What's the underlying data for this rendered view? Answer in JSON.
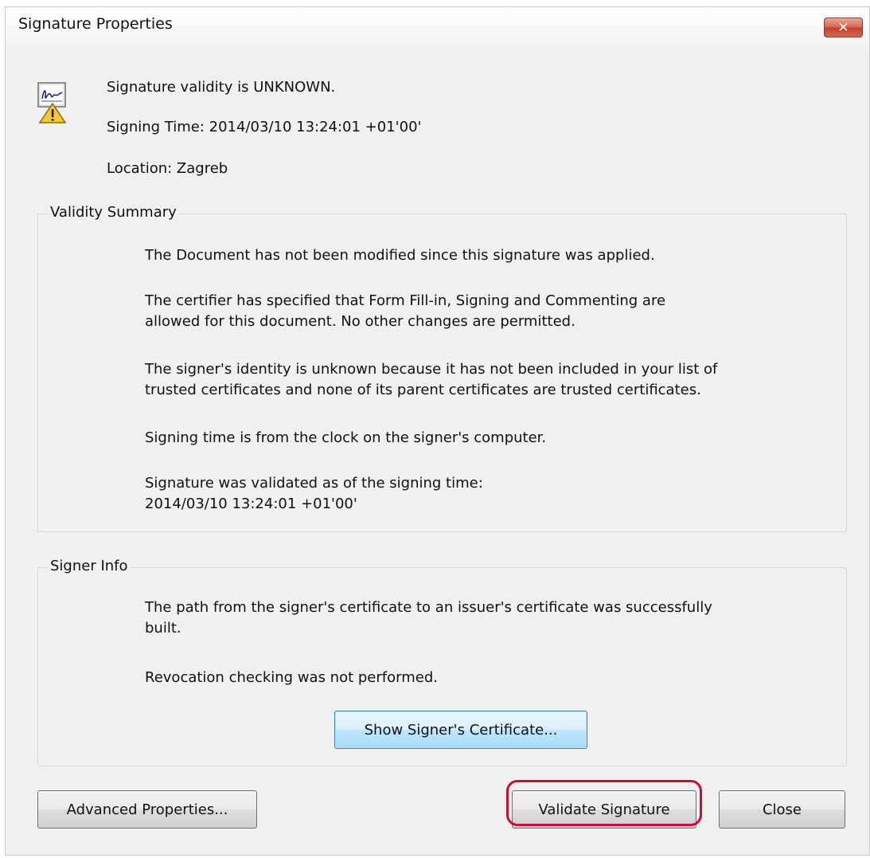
{
  "window": {
    "title": "Signature Properties",
    "close_glyph": "✕"
  },
  "header": {
    "icon": "signature-warning-icon",
    "validity": "Signature validity is UNKNOWN.",
    "signing_time": "Signing Time:  2014/03/10 13:24:01 +01'00'",
    "location": "Location:  Zagreb"
  },
  "validity_summary": {
    "label": "Validity Summary",
    "p1": "The Document has not been modified since this signature was applied.",
    "p2_l1": "The certifier has specified that Form Fill-in, Signing and Commenting are",
    "p2_l2": "allowed for this document. No other changes are permitted.",
    "p3_l1": "The signer's identity is unknown because it has not been included in your list of",
    "p3_l2": "trusted certificates and none of its parent certificates are trusted certificates.",
    "p4": "Signing time is from the clock on the signer's computer.",
    "p5_l1": "Signature was validated as of the signing time:",
    "p5_l2": "2014/03/10 13:24:01 +01'00'"
  },
  "signer_info": {
    "label": "Signer Info",
    "p1_l1": "The path from the signer's certificate to an issuer's certificate was successfully",
    "p1_l2": "built.",
    "p2": "Revocation checking was not performed.",
    "show_cert_button": "Show Signer's Certificate..."
  },
  "footer": {
    "advanced_button": "Advanced Properties...",
    "validate_button": "Validate Signature",
    "close_button": "Close"
  },
  "colors": {
    "highlight": "#c8102e",
    "dialog_bg": "#f0f0f0",
    "focus_button": "#bee6fd"
  }
}
